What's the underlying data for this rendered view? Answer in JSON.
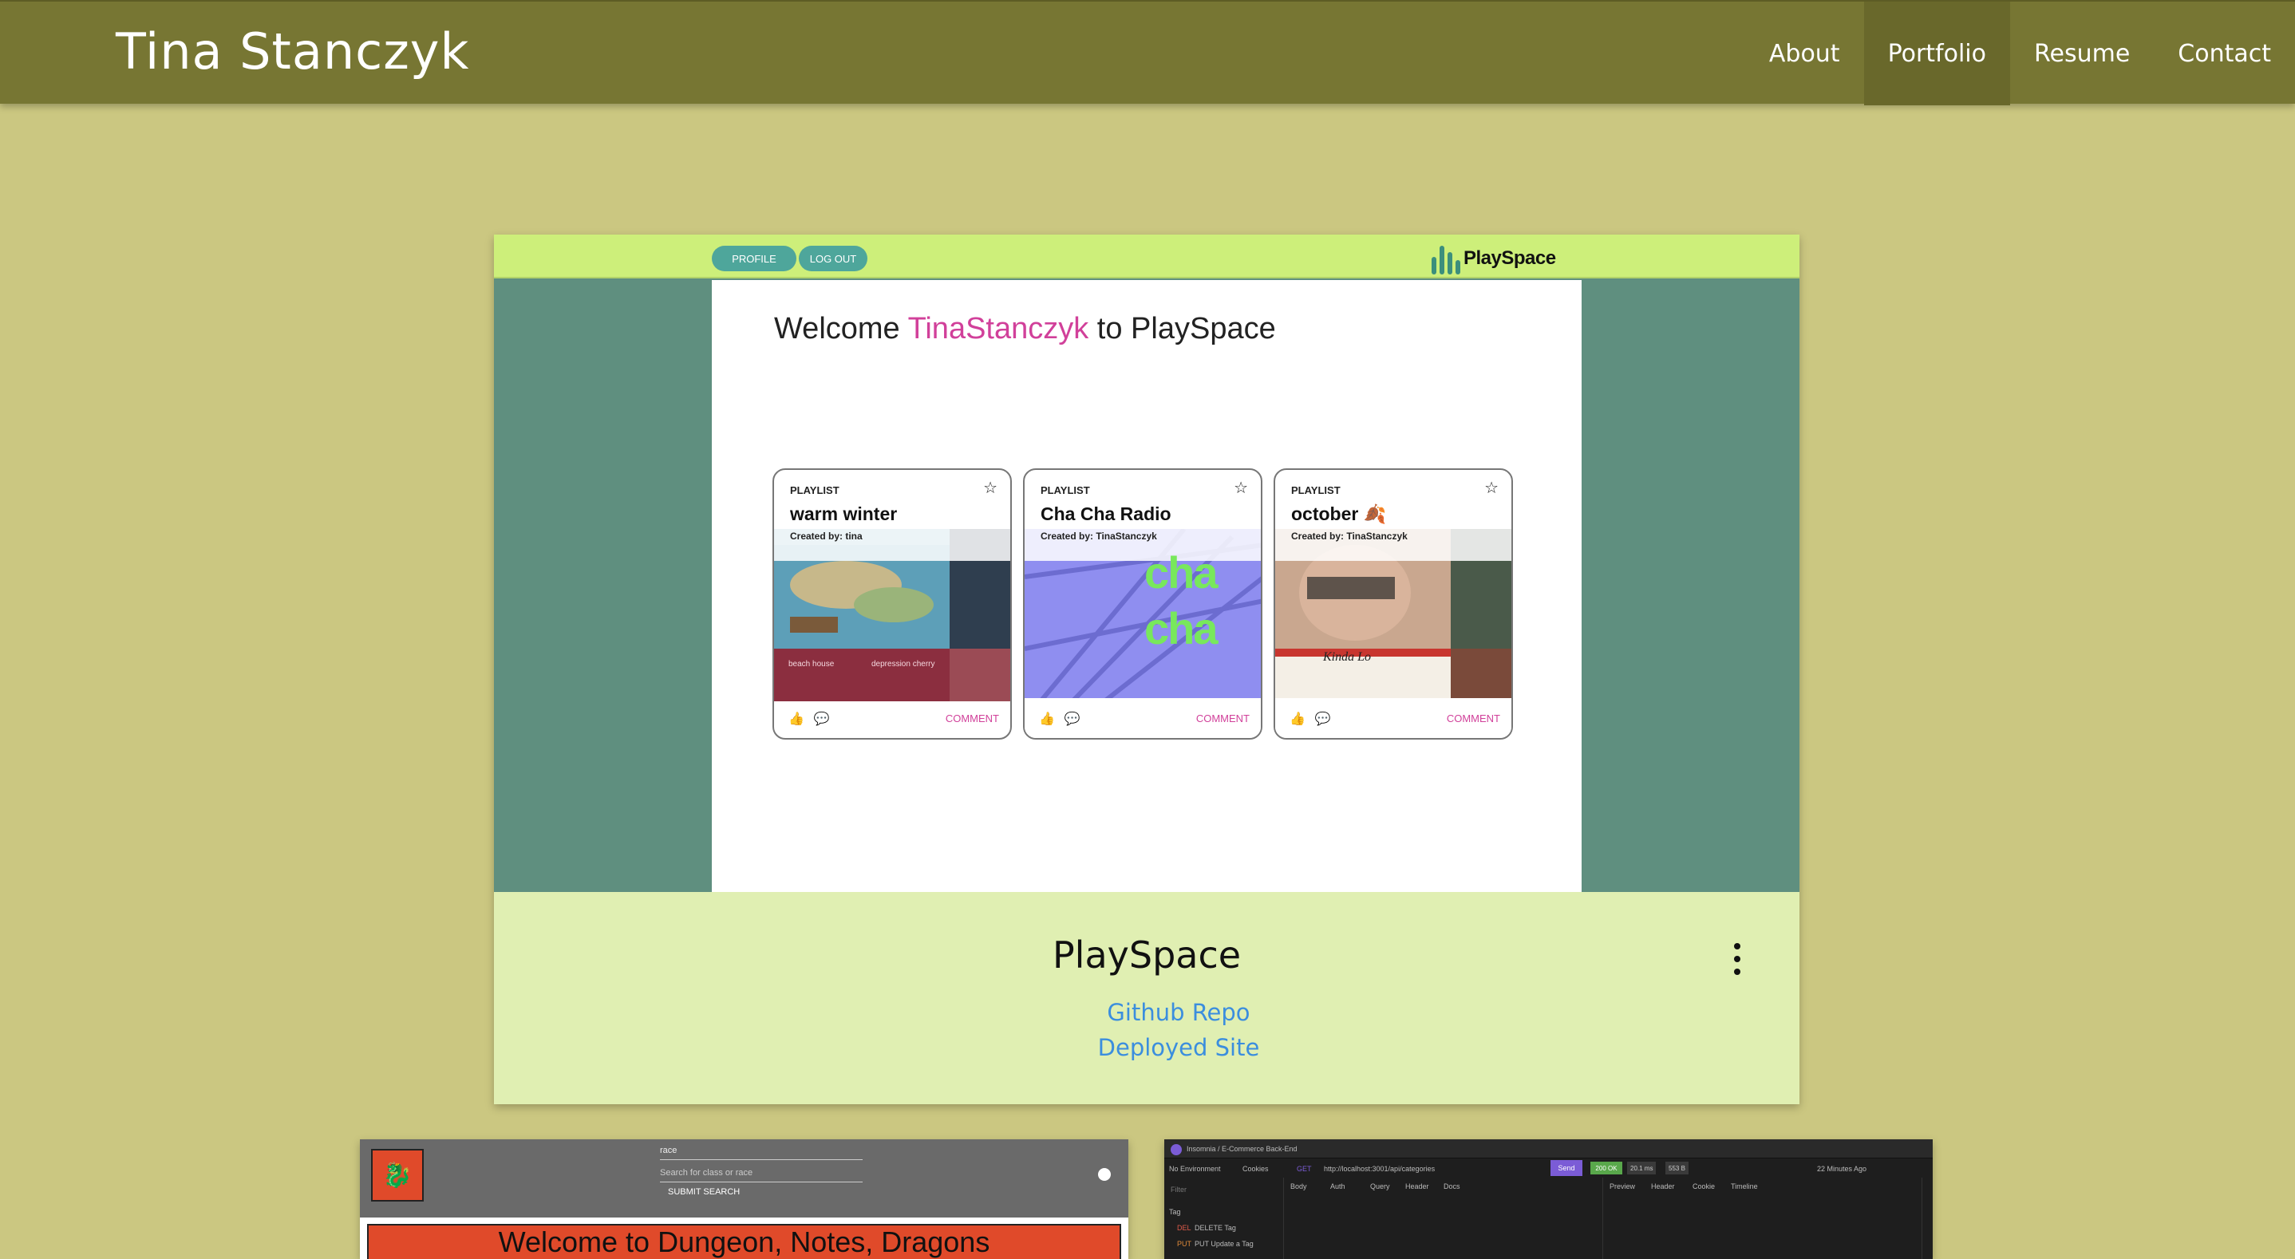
{
  "navbar": {
    "brand": "Tina Stanczyk",
    "items": [
      {
        "label": "About",
        "active": false
      },
      {
        "label": "Portfolio",
        "active": true
      },
      {
        "label": "Resume",
        "active": false
      },
      {
        "label": "Contact",
        "active": false
      }
    ]
  },
  "featured": {
    "screenshot": {
      "profile_button": "PROFILE",
      "logout_button": "LOG OUT",
      "logo_text": "PlaySpace",
      "welcome_prefix": "Welcome ",
      "welcome_user": "TinaStanczyk",
      "welcome_suffix": " to PlaySpace",
      "playlists": [
        {
          "label": "PLAYLIST",
          "title": "warm winter",
          "created_by": "Created by: tina",
          "art_caption_1": "beach house",
          "art_caption_2": "depression cherry",
          "comment": "COMMENT"
        },
        {
          "label": "PLAYLIST",
          "title": "Cha Cha Radio",
          "created_by": "Created by: TinaStanczyk",
          "art_caption_1": "cha",
          "art_caption_2": "cha",
          "comment": "COMMENT"
        },
        {
          "label": "PLAYLIST",
          "title": "october 🍂",
          "created_by": "Created by: TinaStanczyk",
          "art_caption_1": "Kinda Lo",
          "art_caption_2": "",
          "comment": "COMMENT"
        }
      ]
    },
    "title": "PlaySpace",
    "links": {
      "github": "Github Repo",
      "deployed": "Deployed Site"
    }
  },
  "bottom_left": {
    "select_value": "race",
    "search_placeholder": "Search for class or race",
    "submit_label": "SUBMIT SEARCH",
    "welcome": "Welcome to Dungeon, Notes, Dragons"
  },
  "bottom_right": {
    "app_crumb": "Insomnia / E-Commerce Back-End",
    "environment": "No Environment",
    "cookies": "Cookies",
    "method": "GET",
    "url": "http://localhost:3001/api/categories",
    "send": "Send",
    "status": "200 OK",
    "time": "20.1 ms",
    "size": "553 B",
    "age": "22 Minutes Ago",
    "filter": "Filter",
    "tabs": [
      "Body",
      "Auth",
      "Query",
      "Header",
      "Docs"
    ],
    "response_tabs": [
      "Preview",
      "Header",
      "Cookie",
      "Timeline"
    ],
    "sidebar_group": "Tag",
    "sidebar_items": [
      {
        "method": "DEL",
        "label": "DELETE Tag"
      },
      {
        "method": "PUT",
        "label": "PUT Update a Tag"
      }
    ]
  },
  "colors": {
    "page_background": "#cbc781",
    "navbar": "#777633",
    "navbar_active": "#69682b",
    "card_background": "#e0efb2",
    "link": "#3b8ede",
    "playspace_accent": "#d1409a",
    "playspace_teal": "#5f8f7f"
  }
}
